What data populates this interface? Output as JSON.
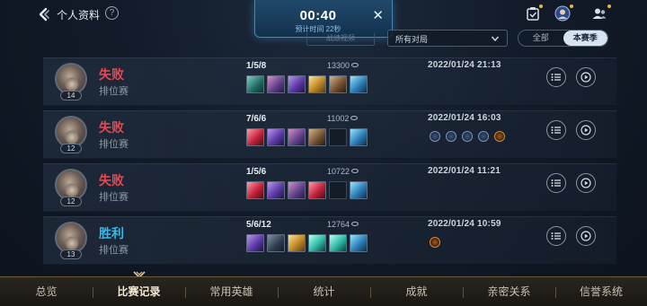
{
  "header": {
    "title": "个人资料",
    "help_glyph": "?"
  },
  "timer": {
    "value": "00:40",
    "subtitle": "预计时间 22秒",
    "close_glyph": "✕"
  },
  "filters": {
    "ghost_button": "战绩视频",
    "dropdown_value": "所有对局",
    "segment": [
      "全部",
      "本赛季"
    ],
    "segment_active": "本赛季"
  },
  "matches": [
    {
      "result": "失败",
      "result_type": "loss",
      "mode": "排位赛",
      "level": "14",
      "kda": "1/5/8",
      "score": "13300",
      "items": [
        "teal",
        "purple",
        "violet",
        "gold",
        "brown",
        "blue"
      ],
      "datetime": "2022/01/24 21:13",
      "badges": []
    },
    {
      "result": "失败",
      "result_type": "loss",
      "mode": "排位赛",
      "level": "12",
      "kda": "7/6/6",
      "score": "11002",
      "items": [
        "red",
        "violet",
        "purple",
        "brown",
        "empty",
        "blue"
      ],
      "datetime": "2022/01/24 16:03",
      "badges": [
        "blue",
        "blue",
        "blue",
        "blue",
        "orange"
      ]
    },
    {
      "result": "失败",
      "result_type": "loss",
      "mode": "排位赛",
      "level": "12",
      "kda": "1/5/6",
      "score": "10722",
      "items": [
        "red",
        "violet",
        "purple",
        "red",
        "empty",
        "blue"
      ],
      "datetime": "2022/01/24 11:21",
      "badges": []
    },
    {
      "result": "胜利",
      "result_type": "win",
      "mode": "排位赛",
      "level": "13",
      "kda": "5/6/12",
      "score": "12764",
      "items": [
        "violet",
        "dark",
        "gold",
        "cyan",
        "cyan",
        "blue"
      ],
      "datetime": "2022/01/24 10:59",
      "badges": [
        "orange"
      ]
    }
  ],
  "nav": {
    "items": [
      "总览",
      "比赛记录",
      "常用英雄",
      "统计",
      "成就",
      "亲密关系",
      "信誉系统"
    ],
    "active": "比赛记录"
  },
  "colors": {
    "loss": "#e4494f",
    "win": "#3bb6e6",
    "timer_bg": "#173957"
  }
}
